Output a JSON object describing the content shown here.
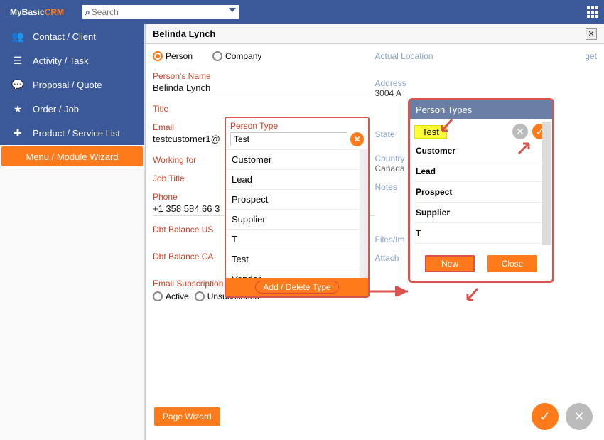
{
  "logo": {
    "prefix": "MyBasic",
    "suffix": "CRM"
  },
  "search": {
    "placeholder": "Search"
  },
  "sidebar": {
    "items": [
      {
        "icon": "👥",
        "label": "Contact / Client"
      },
      {
        "icon": "☰",
        "label": "Activity / Task"
      },
      {
        "icon": "💬",
        "label": "Proposal / Quote"
      },
      {
        "icon": "★",
        "label": "Order / Job"
      },
      {
        "icon": "✚",
        "label": "Product / Service List"
      }
    ],
    "wizard": "Menu / Module Wizard"
  },
  "panel": {
    "title": "Belinda Lynch"
  },
  "radios": {
    "person": "Person",
    "company": "Company"
  },
  "left_fields": {
    "name_lbl": "Person's Name",
    "name_val": "Belinda Lynch",
    "title_lbl": "Title",
    "email_lbl": "Email",
    "email_val": "testcustomer1@",
    "working_lbl": "Working for",
    "job_lbl": "Job Title",
    "phone_lbl": "Phone",
    "phone_val": "+1 358 584 66 3",
    "dbt_us_lbl": "Dbt Balance US",
    "dbt_ca_lbl": "Dbt Balance CA",
    "subs_lbl": "Email Subscription Status",
    "active": "Active",
    "unsub": "Unsubscribed"
  },
  "right_fields": {
    "actual_loc": "Actual Location",
    "get": "get",
    "address_lbl": "Address",
    "address_val": "3004 A",
    "state": "State",
    "country_lbl": "Country",
    "country_val": "Canada",
    "notes": "Notes",
    "files": "Files/Im",
    "attach": "Attach"
  },
  "popup1": {
    "title": "Person Type",
    "input": "Test",
    "items": [
      "Customer",
      "Lead",
      "Prospect",
      "Supplier",
      "T",
      "Test",
      "Vendor"
    ],
    "footer": "Add / Delete Type"
  },
  "popup2": {
    "title": "Person Types",
    "highlight": "Test",
    "items": [
      "Customer",
      "Lead",
      "Prospect",
      "Supplier",
      "T"
    ],
    "new": "New",
    "close": "Close"
  },
  "pagewiz": "Page Wizard"
}
